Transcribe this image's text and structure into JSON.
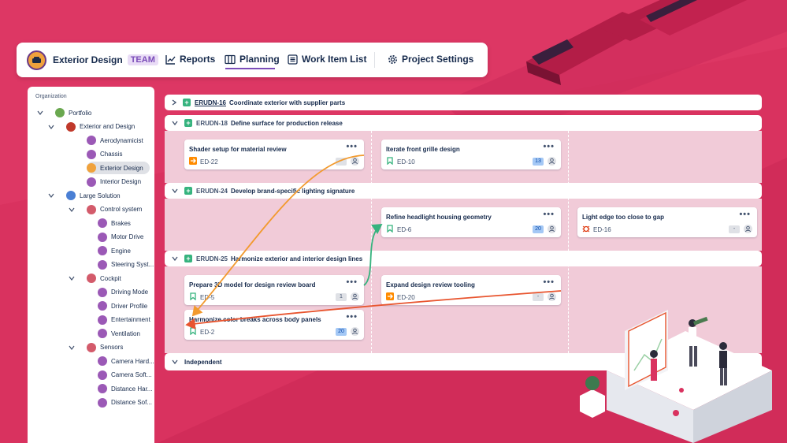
{
  "nav": {
    "project_name": "Exterior Design",
    "badge": "TEAM",
    "items": [
      {
        "label": "Reports",
        "icon": "chart-line-icon"
      },
      {
        "label": "Planning",
        "icon": "board-columns-icon",
        "active": true
      },
      {
        "label": "Work Item List",
        "icon": "list-icon"
      },
      {
        "label": "Project Settings",
        "icon": "gear-icon"
      }
    ]
  },
  "sidebar": {
    "title": "Organization",
    "tree": [
      {
        "label": "Portfolio",
        "level": 0,
        "expanded": true,
        "color": "#6aa84f"
      },
      {
        "label": "Exterior and Design",
        "level": 1,
        "expanded": true,
        "color": "#c0392b"
      },
      {
        "label": "Aerodynamicist",
        "level": 2,
        "color": "#9b59b6"
      },
      {
        "label": "Chassis",
        "level": 2,
        "color": "#9b59b6"
      },
      {
        "label": "Exterior Design",
        "level": 2,
        "color": "#f0a23c",
        "selected": true
      },
      {
        "label": "Interior Design",
        "level": 2,
        "color": "#9b59b6"
      },
      {
        "label": "Large Solution",
        "level": 1,
        "expanded": true,
        "color": "#4a7fd4"
      },
      {
        "label": "Control system",
        "level": 2,
        "expanded": true,
        "color": "#d35b6b"
      },
      {
        "label": "Brakes",
        "level": 3,
        "color": "#9b59b6"
      },
      {
        "label": "Motor Drive",
        "level": 3,
        "color": "#9b59b6"
      },
      {
        "label": "Engine",
        "level": 3,
        "color": "#9b59b6"
      },
      {
        "label": "Steering Syst...",
        "level": 3,
        "color": "#9b59b6"
      },
      {
        "label": "Cockpit",
        "level": 2,
        "expanded": true,
        "color": "#d35b6b"
      },
      {
        "label": "Driving Mode",
        "level": 3,
        "color": "#9b59b6"
      },
      {
        "label": "Driver Profile",
        "level": 3,
        "color": "#9b59b6"
      },
      {
        "label": "Entertainment",
        "level": 3,
        "color": "#9b59b6"
      },
      {
        "label": "Ventilation",
        "level": 3,
        "color": "#9b59b6"
      },
      {
        "label": "Sensors",
        "level": 2,
        "expanded": true,
        "color": "#d35b6b"
      },
      {
        "label": "Camera Hard...",
        "level": 3,
        "color": "#9b59b6"
      },
      {
        "label": "Camera Soft...",
        "level": 3,
        "color": "#9b59b6"
      },
      {
        "label": "Distance Har...",
        "level": 3,
        "color": "#9b59b6"
      },
      {
        "label": "Distance Sof...",
        "level": 3,
        "color": "#9b59b6"
      }
    ]
  },
  "board": {
    "lanes": [
      {
        "key": "ERUDN-16",
        "title": "Coordinate exterior with supplier parts",
        "collapsed": true
      },
      {
        "key": "ERUDN-18",
        "title": "Define surface for production release"
      },
      {
        "key": "ERUDN-24",
        "title": "Develop brand-specific lighting signature"
      },
      {
        "key": "ERUDN-25",
        "title": "Harmonize exterior and interior design lines"
      }
    ],
    "independent_label": "Independent",
    "cards": [
      {
        "title": "Shader setup for material review",
        "key": "ED-22",
        "type": "task",
        "estimate": "-",
        "est_style": "grey"
      },
      {
        "title": "Iterate front grille design",
        "key": "ED-10",
        "type": "story",
        "estimate": "13",
        "est_style": "blue"
      },
      {
        "title": "Refine headlight housing geometry",
        "key": "ED-6",
        "type": "story",
        "estimate": "20",
        "est_style": "blue"
      },
      {
        "title": "Light edge too close to gap",
        "key": "ED-16",
        "type": "bug",
        "estimate": "-",
        "est_style": "grey"
      },
      {
        "title": "Prepare 3D model for design review board",
        "key": "ED-5",
        "type": "story",
        "estimate": "1",
        "est_style": "grey"
      },
      {
        "title": "Expand design review tooling",
        "key": "ED-20",
        "type": "task",
        "estimate": "-",
        "est_style": "grey"
      },
      {
        "title": "Harmonize color breaks across body panels",
        "key": "ED-2",
        "type": "story",
        "estimate": "20",
        "est_style": "blue"
      }
    ],
    "more_glyph": "•••"
  },
  "colors": {
    "background": "#d9325f",
    "accent": "#7a4cb8",
    "dependency_orange": "#f29a2e",
    "dependency_green": "#36b37e",
    "dependency_red": "#e8552f",
    "story": "#36b37e",
    "task": "#ff8b00",
    "bug": "#de350b"
  }
}
